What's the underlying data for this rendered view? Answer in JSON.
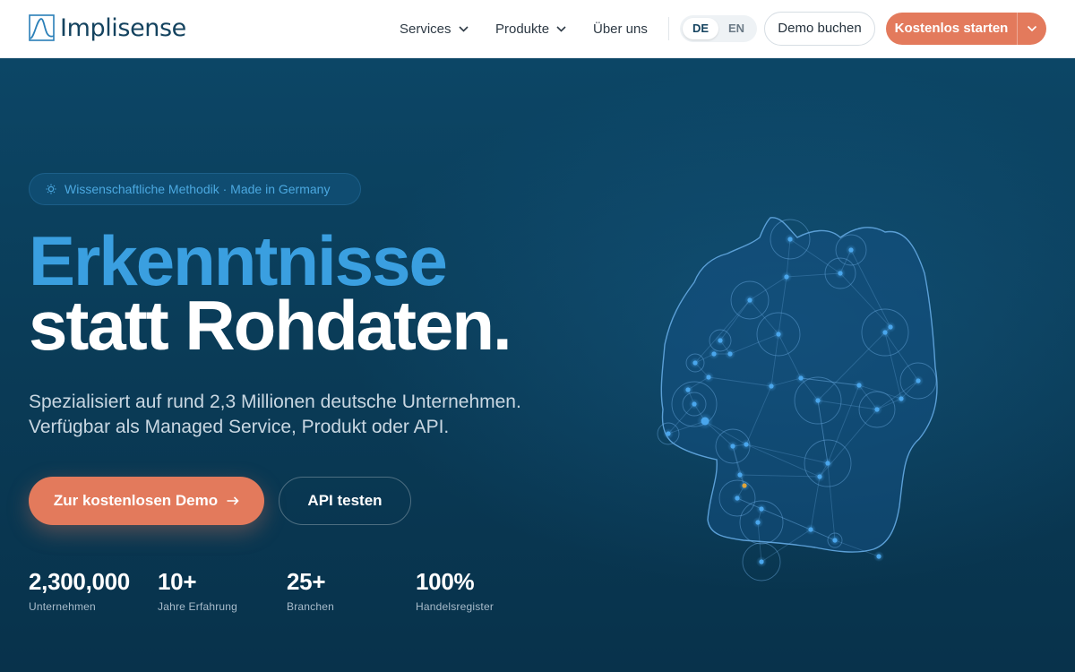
{
  "brand": {
    "name": "Implisense",
    "logo_icon": "wave-line-logo-icon",
    "color": "#14435f"
  },
  "nav": {
    "services_label": "Services",
    "products_label": "Produkte",
    "about_label": "Über uns"
  },
  "language": {
    "options": [
      "DE",
      "EN"
    ],
    "selected": "DE"
  },
  "header_buttons": {
    "demo_label": "Demo buchen",
    "start_label": "Kostenlos starten"
  },
  "hero": {
    "badge": "Wissenschaftliche Methodik · Made in Germany",
    "badge_icon": "lightbulb-icon",
    "headline_line1": "Erkenntnisse",
    "headline_line2": "statt Rohdaten.",
    "subtext_line1": "Spezialisiert auf rund 2,3 Millionen deutsche Unternehmen.",
    "subtext_line2": "Verfügbar als Managed Service, Produkt oder API.",
    "cta_primary": "Zur kostenlosen Demo",
    "cta_primary_icon": "arrow-right-icon",
    "cta_secondary": "API testen"
  },
  "stats": [
    {
      "value": "2,300,000",
      "label": "Unternehmen"
    },
    {
      "value": "10+",
      "label": "Jahre Erfahrung"
    },
    {
      "value": "25+",
      "label": "Branchen"
    },
    {
      "value": "100%",
      "label": "Handelsregister"
    }
  ],
  "colors": {
    "accent_orange": "#e37a5c",
    "accent_blue": "#3a9fe0",
    "hero_background": "#0a3c58",
    "map_node": "#4aa6ec",
    "map_highlight": "#e0a43a"
  },
  "map": {
    "illustration": "germany-network-map"
  }
}
